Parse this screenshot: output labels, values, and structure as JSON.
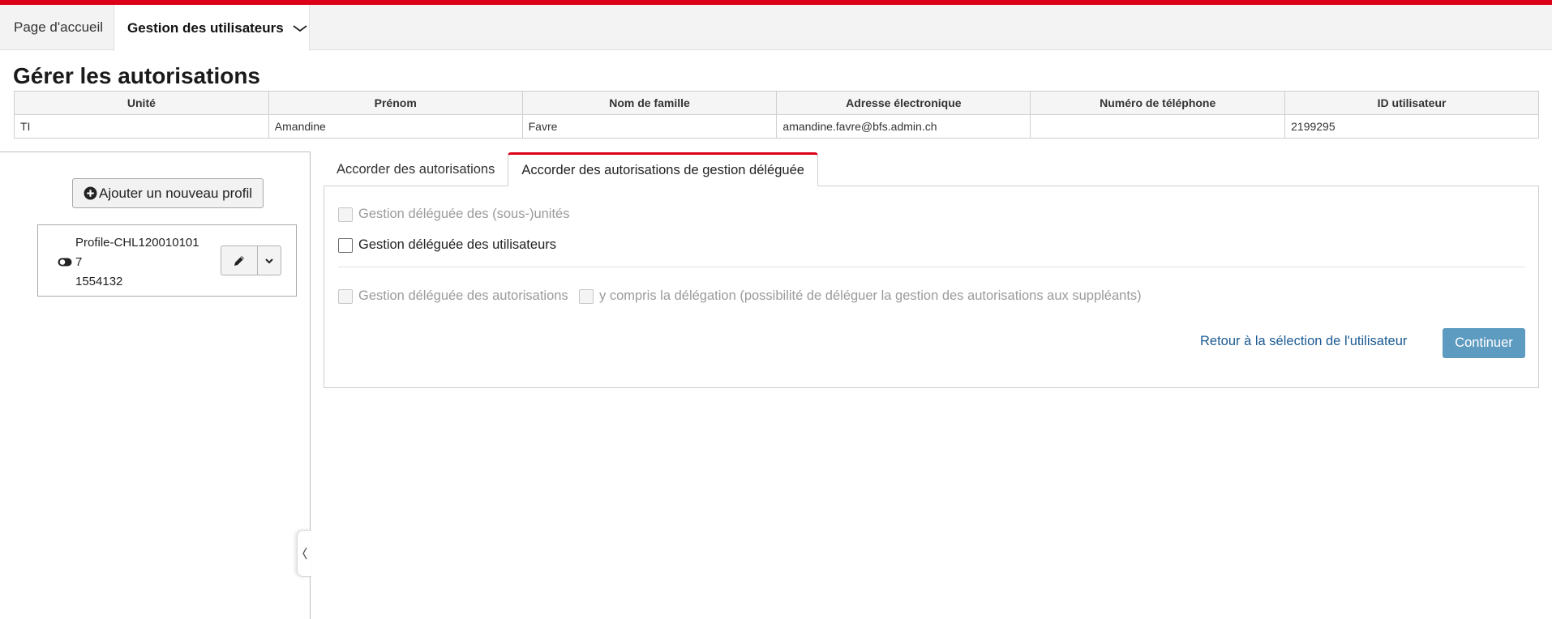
{
  "nav": {
    "home_label": "Page d'accueil",
    "users_label": "Gestion des utilisateurs",
    "accent_color": "#dc0018"
  },
  "page": {
    "title": "Gérer les autorisations"
  },
  "user_table": {
    "headers": [
      "Unité",
      "Prénom",
      "Nom de famille",
      "Adresse électronique",
      "Numéro de téléphone",
      "ID utilisateur"
    ],
    "row": [
      "TI",
      "Amandine",
      "Favre",
      "amandine.favre@bfs.admin.ch",
      "",
      "2199295"
    ]
  },
  "profiles": {
    "add_button_label": "Ajouter un nouveau profil",
    "add_icon": "plus-circle-icon",
    "items": [
      {
        "name": "Profile-CHL1200101017 1554132",
        "name_line1": "Profile-CHL120010101",
        "name_line2": "7",
        "name_line3": "1554132",
        "status_icon": "toggle-icon"
      }
    ]
  },
  "tabs": {
    "items": [
      {
        "label": "Accorder des autorisations",
        "active": false
      },
      {
        "label": "Accorder des autorisations de gestion déléguée",
        "active": true
      }
    ]
  },
  "delegated": {
    "opt_subunits": {
      "label": "Gestion déléguée des (sous-)unités",
      "checked": false,
      "disabled": true
    },
    "opt_users": {
      "label": "Gestion déléguée des utilisateurs",
      "checked": false,
      "disabled": false
    },
    "opt_permissions": {
      "label": "Gestion déléguée des autorisations",
      "checked": false,
      "disabled": true
    },
    "opt_include_delegation": {
      "label": "y compris la délégation (possibilité de déléguer la gestion des autorisations aux suppléants)",
      "checked": false,
      "disabled": true
    }
  },
  "actions": {
    "back_label": "Retour à la sélection de l'utilisateur",
    "continue_label": "Continuer",
    "continue_color": "#5e9bc0",
    "link_color": "#1b5a92"
  }
}
